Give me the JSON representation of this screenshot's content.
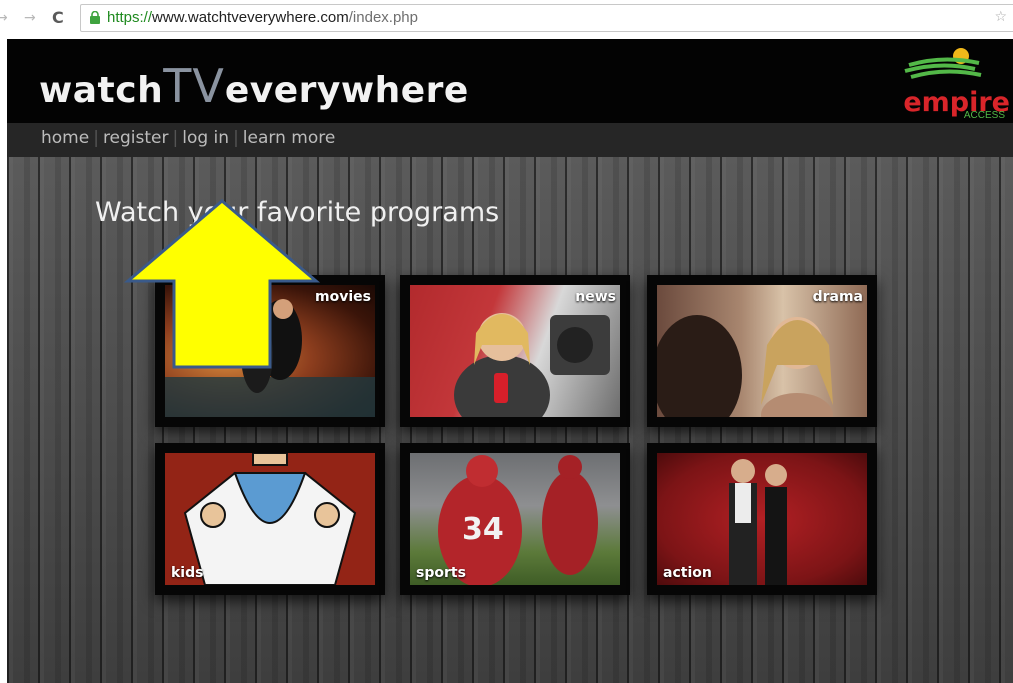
{
  "browser": {
    "url_scheme": "https://",
    "url_host": "www.watchtveverywhere.com",
    "url_path": "/index.php"
  },
  "site": {
    "logo_prefix": "watch",
    "logo_tv": "TV",
    "logo_suffix": "everywhere",
    "partner": {
      "name": "empire",
      "subtitle": "ACCESS"
    },
    "nav": [
      {
        "label": "home"
      },
      {
        "label": "register"
      },
      {
        "label": "log in"
      },
      {
        "label": "learn more"
      }
    ],
    "hero_title": "Watch your favorite programs",
    "categories": [
      {
        "label": "movies"
      },
      {
        "label": "news"
      },
      {
        "label": "drama"
      },
      {
        "label": "kids"
      },
      {
        "label": "sports"
      },
      {
        "label": "action"
      }
    ]
  },
  "colors": {
    "arrow_fill": "#ffff00",
    "arrow_stroke": "#3a5a8a",
    "partner_red": "#d9252a",
    "partner_green": "#53b848"
  }
}
